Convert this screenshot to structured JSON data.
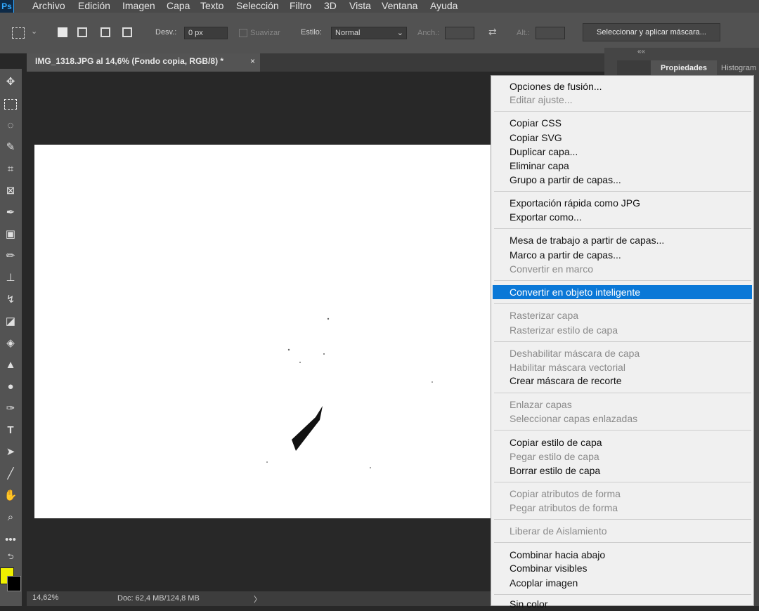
{
  "menubar": {
    "logo": "Ps",
    "items": [
      "Archivo",
      "Edición",
      "Imagen",
      "Capa",
      "Texto",
      "Selección",
      "Filtro",
      "3D",
      "Vista",
      "Ventana",
      "Ayuda"
    ]
  },
  "options": {
    "feather_label": "Desv.:",
    "feather_value": "0 px",
    "antialias_label": "Suavizar",
    "style_label": "Estilo:",
    "style_value": "Normal",
    "width_label": "Anch.:",
    "height_label": "Alt.:",
    "mask_button": "Seleccionar y aplicar máscara..."
  },
  "document": {
    "tab_title": "IMG_1318.JPG al 14,6% (Fondo copia, RGB/8) *",
    "close_glyph": "×"
  },
  "status": {
    "zoom": "14,62%",
    "doc_size": "Doc: 62,4 MB/124,8 MB",
    "arrow": "〉"
  },
  "panels": {
    "collapse_glyph": "««",
    "properties_tab": "Propiedades",
    "histogram_tab": "Histogram"
  },
  "colors": {
    "foreground": "#f0f000",
    "background": "#000000",
    "highlight": "#0a78d7"
  },
  "context_menu": {
    "items": [
      {
        "label": "Opciones de fusión...",
        "disabled": false
      },
      {
        "label": "Editar ajuste...",
        "disabled": true
      },
      {
        "label": "Copiar CSS",
        "disabled": false
      },
      {
        "label": "Copiar SVG",
        "disabled": false
      },
      {
        "label": "Duplicar capa...",
        "disabled": false
      },
      {
        "label": "Eliminar capa",
        "disabled": false
      },
      {
        "label": "Grupo a partir de capas...",
        "disabled": false
      },
      {
        "label": "Exportación rápida como JPG",
        "disabled": false
      },
      {
        "label": "Exportar como...",
        "disabled": false
      },
      {
        "label": "Mesa de trabajo a partir de capas...",
        "disabled": false
      },
      {
        "label": "Marco a partir de capas...",
        "disabled": false
      },
      {
        "label": "Convertir en marco",
        "disabled": true
      },
      {
        "label": "Convertir en objeto inteligente",
        "disabled": false,
        "highlighted": true
      },
      {
        "label": "Rasterizar capa",
        "disabled": true
      },
      {
        "label": "Rasterizar estilo de capa",
        "disabled": true
      },
      {
        "label": "Deshabilitar máscara de capa",
        "disabled": true
      },
      {
        "label": "Habilitar máscara vectorial",
        "disabled": true
      },
      {
        "label": "Crear máscara de recorte",
        "disabled": false
      },
      {
        "label": "Enlazar capas",
        "disabled": true
      },
      {
        "label": "Seleccionar capas enlazadas",
        "disabled": true
      },
      {
        "label": "Copiar estilo de capa",
        "disabled": false
      },
      {
        "label": "Pegar estilo de capa",
        "disabled": true
      },
      {
        "label": "Borrar estilo de capa",
        "disabled": false
      },
      {
        "label": "Copiar atributos de forma",
        "disabled": true
      },
      {
        "label": "Pegar atributos de forma",
        "disabled": true
      },
      {
        "label": "Liberar de Aislamiento",
        "disabled": true
      },
      {
        "label": "Combinar hacia abajo",
        "disabled": false
      },
      {
        "label": "Combinar visibles",
        "disabled": false
      },
      {
        "label": "Acoplar imagen",
        "disabled": false
      },
      {
        "label": "Sin color",
        "disabled": false
      }
    ]
  }
}
